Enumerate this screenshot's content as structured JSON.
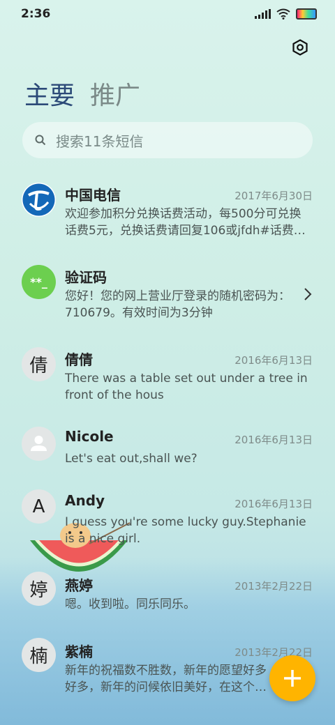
{
  "status": {
    "time": "2:36"
  },
  "tabs": {
    "main": "主要",
    "promo": "推广"
  },
  "search": {
    "placeholder": "搜索11条短信"
  },
  "messages": [
    {
      "name": "中国电信",
      "date": "2017年6月30日",
      "preview": "欢迎参加积分兑换话费活动，每500分可兑换话费5元，兑换话费请回复106或jfdh#话费…",
      "avatar": ""
    },
    {
      "name": "验证码",
      "date": "",
      "preview": "您好！您的网上营业厅登录的随机密码为：710679。有效时间为3分钟",
      "avatar": "**_"
    },
    {
      "name": "倩倩",
      "date": "2016年6月13日",
      "preview": "There was a table set out under a tree in front of the hous",
      "avatar": "倩"
    },
    {
      "name": "Nicole",
      "date": "2016年6月13日",
      "preview": "Let's eat out,shall we?",
      "avatar": ""
    },
    {
      "name": "Andy",
      "date": "2016年6月13日",
      "preview": "I guess you're some lucky guy.Stephanie is a nice girl.",
      "avatar": "A"
    },
    {
      "name": "燕婷",
      "date": "2013年2月22日",
      "preview": "嗯。收到啦。同乐同乐。",
      "avatar": "婷"
    },
    {
      "name": "紫楠",
      "date": "2013年2月22日",
      "preview": "新年的祝福数不胜数，新年的愿望好多好多，新年的问候依旧美好，在这个温馨的时刻…",
      "avatar": "楠"
    }
  ],
  "colors": {
    "accent": "#ffb400",
    "verify_green": "#6ccf4f",
    "telecom_blue": "#1468b8"
  }
}
